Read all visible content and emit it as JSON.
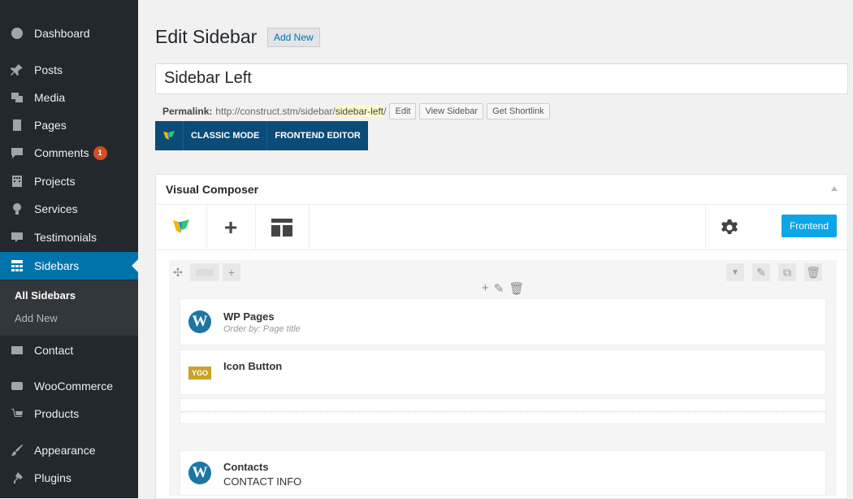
{
  "sidebar": {
    "items": [
      {
        "label": "Dashboard",
        "icon": "dashboard-icon"
      },
      {
        "label": "Posts",
        "icon": "pin-icon"
      },
      {
        "label": "Media",
        "icon": "media-icon"
      },
      {
        "label": "Pages",
        "icon": "pages-icon"
      },
      {
        "label": "Comments",
        "icon": "comment-icon",
        "badge": "1"
      },
      {
        "label": "Projects",
        "icon": "building-icon"
      },
      {
        "label": "Services",
        "icon": "lightbulb-icon"
      },
      {
        "label": "Testimonials",
        "icon": "testimonial-icon"
      },
      {
        "label": "Sidebars",
        "icon": "sidebar-grid-icon"
      },
      {
        "label": "Contact",
        "icon": "mail-icon"
      },
      {
        "label": "WooCommerce",
        "icon": "woo-icon"
      },
      {
        "label": "Products",
        "icon": "cart-icon"
      },
      {
        "label": "Appearance",
        "icon": "brush-icon"
      },
      {
        "label": "Plugins",
        "icon": "plugin-icon"
      }
    ],
    "submenu": [
      "All Sidebars",
      "Add New"
    ]
  },
  "header": {
    "title": "Edit Sidebar",
    "add_new": "Add New"
  },
  "post_title": "Sidebar Left",
  "permalink": {
    "label": "Permalink:",
    "base": "http://construct.stm/sidebar/",
    "slug": "sidebar-left",
    "trail": "/",
    "edit": "Edit",
    "view": "View Sidebar",
    "shortlink": "Get Shortlink"
  },
  "modes": {
    "classic": "CLASSIC MODE",
    "frontend": "FRONTEND EDITOR"
  },
  "vc": {
    "title": "Visual Composer",
    "frontend_button": "Frontend",
    "elements": [
      {
        "title": "WP Pages",
        "subtitle": "Order by: Page title"
      },
      {
        "title": "Icon Button",
        "icon_text": "YGO"
      },
      {
        "title": "Contacts",
        "subtitle": "CONTACT INFO"
      }
    ]
  },
  "colors": {
    "sidebar_bg": "#23282d",
    "active": "#0073aa",
    "mode_bar": "#0a4b78",
    "frontend": "#0ba6e8"
  }
}
